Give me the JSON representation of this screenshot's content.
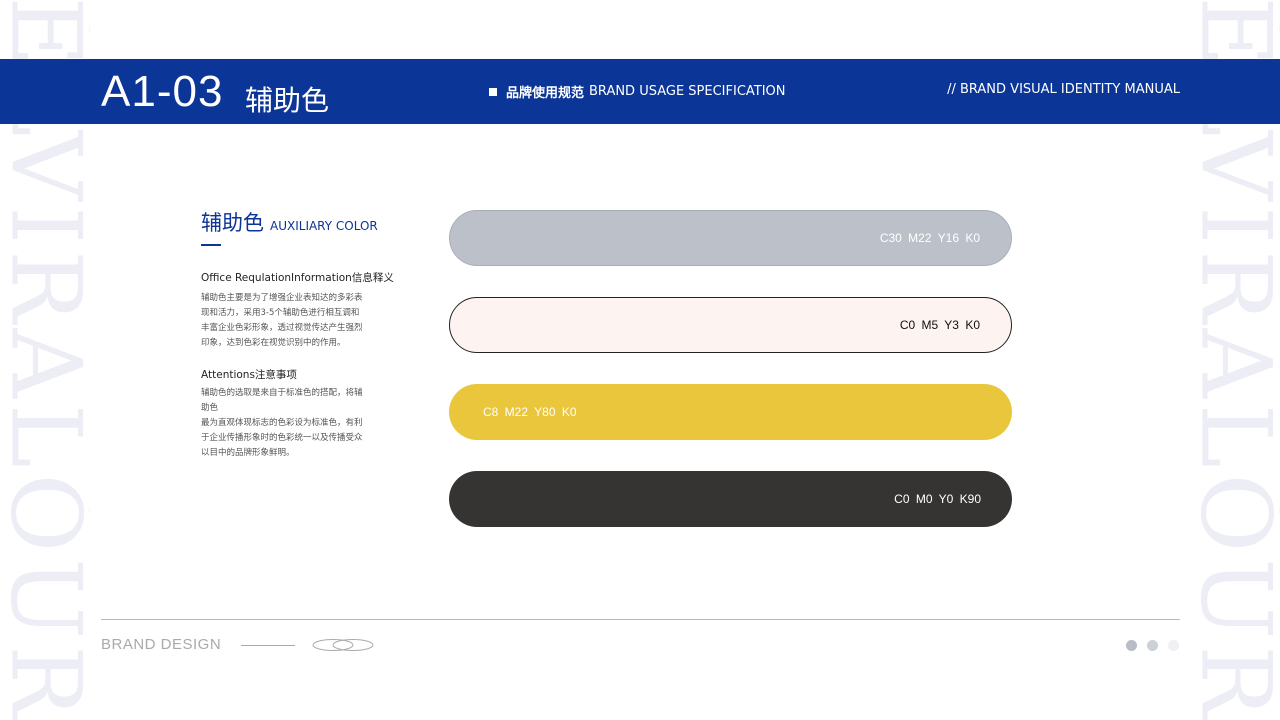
{
  "watermark": {
    "text": "ÉLVIRALÓUR"
  },
  "header": {
    "page_code": "A1-03",
    "page_title": "辅助色",
    "usage_cn": "品牌使用规范",
    "usage_en": "BRAND USAGE SPECIFICATION",
    "manual": "// BRAND VISUAL IDENTITY MANUAL",
    "bar_color": "#0b3596"
  },
  "section": {
    "title_cn": "辅助色",
    "title_en": "AUXILIARY COLOR",
    "info_heading": "Office RequlationInformation信息释义",
    "info_lines": [
      "辅助色主要是为了增强企业表知达的多彩表",
      "现和活力，采用3-5个辅助色进行相互调和",
      "丰富企业色彩形象，透过视觉传达产生强烈",
      "印象，达到色彩在视觉识别中的作用。"
    ],
    "attention_heading": "Attentions注意事项",
    "attention_lines": [
      "辅助色的选取是来自于标准色的搭配，将辅",
      "助色",
      "最为直观体现标志的色彩设为标准色，有利",
      "于企业传播形象时的色彩统一以及传播受众",
      "以目中的品牌形象鲜明。"
    ]
  },
  "swatches": [
    {
      "label": "C30  M22  Y16  K0",
      "color": "#bcc1c9"
    },
    {
      "label": "C0  M5  Y3  K0",
      "color": "#fdf3f0"
    },
    {
      "label": "C8  M22  Y80  K0",
      "color": "#eac63d"
    },
    {
      "label": "C0  M0  Y0  K90",
      "color": "#353432"
    }
  ],
  "footer": {
    "brand": "BRAND DESIGN",
    "page_dots": 3,
    "active_dot": 1
  }
}
